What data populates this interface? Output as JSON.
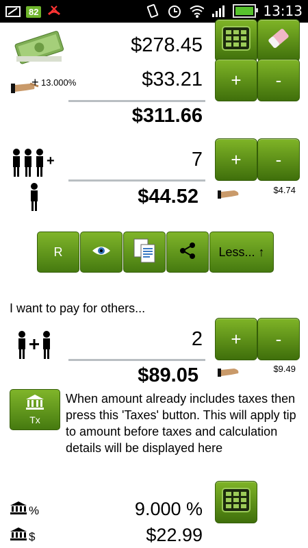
{
  "status": {
    "battery_level": "82",
    "time": "13:13"
  },
  "bill": {
    "amount": "$278.45",
    "tip_percent": "13.000%",
    "tip_amount": "$33.21",
    "total": "$311.66"
  },
  "split": {
    "people_count": "7",
    "per_person": "$44.52",
    "per_person_tip": "$4.74"
  },
  "toolbar": {
    "reset_label": "R",
    "less_label": "Less... ↑"
  },
  "others": {
    "heading": "I want to pay for others...",
    "count": "2",
    "amount": "$89.05",
    "tip": "$9.49"
  },
  "taxes": {
    "button_label": "Tx",
    "info": "When amount already includes taxes then press this 'Taxes' button. This will apply tip to amount before taxes and calculation details will be displayed here",
    "percent_symbol": "%",
    "percent_value": "9.000 %",
    "dollar_symbol": "$",
    "dollar_value": "$22.99"
  },
  "buttons": {
    "plus": "+",
    "minus": "-"
  },
  "colors": {
    "button_green": "#5a9418",
    "rule_gray": "#b9bec2"
  }
}
